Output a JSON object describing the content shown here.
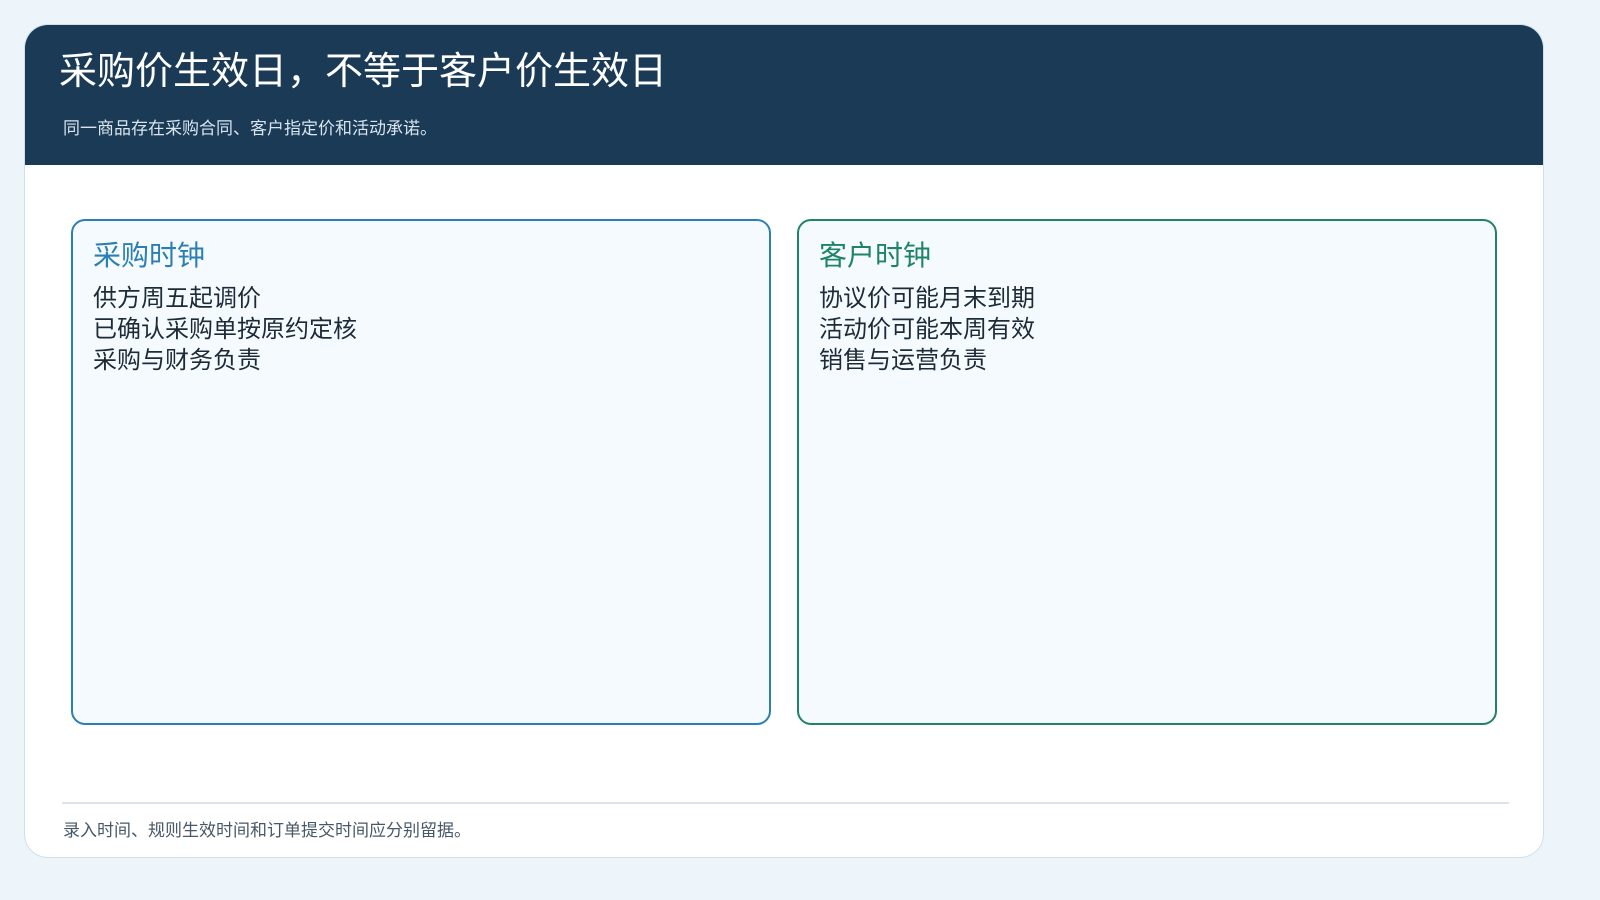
{
  "header": {
    "title": "采购价生效日，不等于客户价生效日",
    "subtitle": "同一商品存在采购合同、客户指定价和活动承诺。"
  },
  "panels": [
    {
      "title": "采购时钟",
      "lines": [
        "供方周五起调价",
        "已确认采购单按原约定核",
        "采购与财务负责"
      ],
      "accent": "#2b7fb4"
    },
    {
      "title": "客户时钟",
      "lines": [
        "协议价可能月末到期",
        "活动价可能本周有效",
        "销售与运营负责"
      ],
      "accent": "#1e8466"
    }
  ],
  "footer": {
    "note": "录入时间、规则生效时间和订单提交时间应分别留据。"
  },
  "colors": {
    "header_bg": "#1b3a56",
    "page_bg": "#eef5fa"
  }
}
